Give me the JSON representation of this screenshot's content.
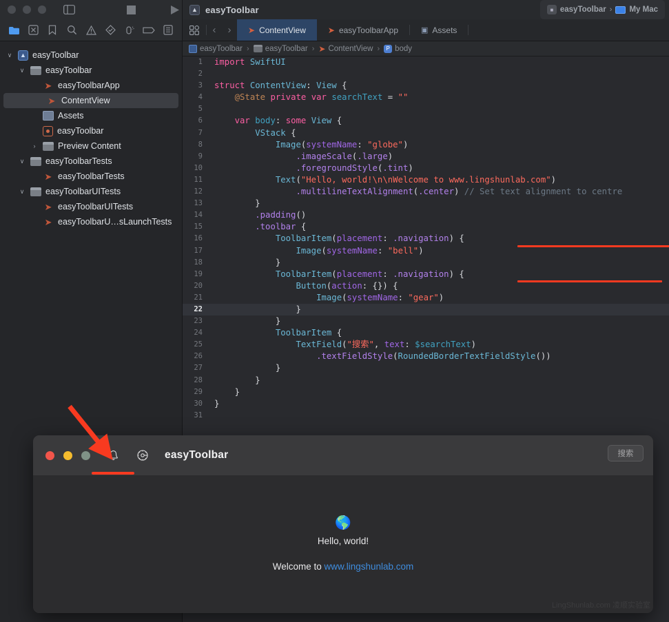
{
  "titlebar": {
    "window_controls": [
      "close",
      "minimize",
      "zoom"
    ],
    "sidebar_toggle_icon": "sidebar-toggle-icon",
    "grid_icon": "grid-icon",
    "run_icon": "run-play-icon",
    "project_icon": "xcode-project-icon",
    "project_title": "easyToolbar",
    "scheme": {
      "icon": "scheme-icon",
      "name": "easyToolbar",
      "chevron": "›",
      "device_icon": "mac-icon",
      "device": "My Mac"
    }
  },
  "navigator_toolbar": {
    "icons": [
      "folder-project-navigator-icon",
      "source-control-navigator-icon",
      "bookmark-navigator-icon",
      "find-navigator-icon",
      "issue-navigator-icon",
      "test-navigator-icon",
      "debug-navigator-icon",
      "breakpoint-navigator-icon",
      "report-navigator-icon"
    ]
  },
  "editor_tabbar": {
    "grid_button": "editor-grid-icon",
    "back_label": "‹",
    "forward_label": "›",
    "tabs": [
      {
        "label": "ContentView",
        "icon": "swift-file-icon",
        "selected": true
      },
      {
        "label": "easyToolbarApp",
        "icon": "swift-file-icon",
        "selected": false
      },
      {
        "label": "Assets",
        "icon": "assets-icon",
        "selected": false
      }
    ]
  },
  "breadcrumb": {
    "items": [
      {
        "label": "easyToolbar",
        "icon": "xcode-project-icon"
      },
      {
        "label": "easyToolbar",
        "icon": "folder-icon"
      },
      {
        "label": "ContentView",
        "icon": "swift-file-icon"
      },
      {
        "label": "body",
        "icon": "body-symbol-icon"
      }
    ],
    "separator": "›"
  },
  "sidebar": {
    "items": [
      {
        "label": "easyToolbar",
        "indent": 0,
        "disclosure": "∨",
        "icon": "xcode-project-icon",
        "selected": false
      },
      {
        "label": "easyToolbar",
        "indent": 1,
        "disclosure": "∨",
        "icon": "folder-icon",
        "selected": false
      },
      {
        "label": "easyToolbarApp",
        "indent": 2,
        "disclosure": "",
        "icon": "swift-file-icon",
        "selected": false
      },
      {
        "label": "ContentView",
        "indent": 2,
        "disclosure": "",
        "icon": "swift-file-icon",
        "selected": true
      },
      {
        "label": "Assets",
        "indent": 2,
        "disclosure": "",
        "icon": "assets-icon",
        "selected": false
      },
      {
        "label": "easyToolbar",
        "indent": 2,
        "disclosure": "",
        "icon": "entitlements-icon",
        "selected": false
      },
      {
        "label": "Preview Content",
        "indent": 2,
        "disclosure": "›",
        "icon": "folder-icon",
        "selected": false
      },
      {
        "label": "easyToolbarTests",
        "indent": 1,
        "disclosure": "∨",
        "icon": "folder-icon",
        "selected": false
      },
      {
        "label": "easyToolbarTests",
        "indent": 2,
        "disclosure": "",
        "icon": "swift-file-icon",
        "selected": false
      },
      {
        "label": "easyToolbarUITests",
        "indent": 1,
        "disclosure": "∨",
        "icon": "folder-icon",
        "selected": false
      },
      {
        "label": "easyToolbarUITests",
        "indent": 2,
        "disclosure": "",
        "icon": "swift-file-icon",
        "selected": false
      },
      {
        "label": "easyToolbarU…sLaunchTests",
        "indent": 2,
        "disclosure": "",
        "icon": "swift-file-icon",
        "selected": false
      }
    ]
  },
  "editor": {
    "current_line": 22,
    "lines": [
      {
        "n": 1,
        "html": "<span class='k'>import</span> <span class='t'>SwiftUI</span>"
      },
      {
        "n": 2,
        "html": ""
      },
      {
        "n": 3,
        "html": "<span class='k'>struct</span> <span class='t'>ContentView</span><span class='d'>: </span><span class='t'>View</span> <span class='d'>{</span>"
      },
      {
        "n": 4,
        "html": "    <span class='attr'>@State</span> <span class='k'>private</span> <span class='k'>var</span> <span class='v'>searchText</span> <span class='d'>= </span><span class='s'>\"\"</span>"
      },
      {
        "n": 5,
        "html": ""
      },
      {
        "n": 6,
        "html": "    <span class='k'>var</span> <span class='v'>body</span><span class='d'>: </span><span class='k'>some</span> <span class='t'>View</span> <span class='d'>{</span>"
      },
      {
        "n": 7,
        "html": "        <span class='t'>VStack</span> <span class='d'>{</span>"
      },
      {
        "n": 8,
        "html": "            <span class='t'>Image</span><span class='d'>(</span><span class='p'>systemName</span><span class='d'>: </span><span class='s'>\"globe\"</span><span class='d'>)</span>"
      },
      {
        "n": 9,
        "html": "                <span class='f'>.imageScale</span><span class='d'>(</span><span class='f'>.large</span><span class='d'>)</span>"
      },
      {
        "n": 10,
        "html": "                <span class='f'>.foregroundStyle</span><span class='d'>(</span><span class='f'>.tint</span><span class='d'>)</span>"
      },
      {
        "n": 11,
        "html": "            <span class='t'>Text</span><span class='d'>(</span><span class='s'>\"Hello, world!\\n\\nWelcome to www.lingshunlab.com\"</span><span class='d'>)</span>"
      },
      {
        "n": 12,
        "html": "                <span class='f'>.multilineTextAlignment</span><span class='d'>(</span><span class='f'>.center</span><span class='d'>) </span><span class='c'>// Set text alignment to centre</span>"
      },
      {
        "n": 13,
        "html": "        <span class='d'>}</span>"
      },
      {
        "n": 14,
        "html": "        <span class='f'>.padding</span><span class='d'>()</span>"
      },
      {
        "n": 15,
        "html": "        <span class='f'>.toolbar</span> <span class='d'>{</span>"
      },
      {
        "n": 16,
        "html": "            <span class='t'>ToolbarItem</span><span class='d'>(</span><span class='p'>placement</span><span class='d'>: </span><span class='f'>.navigation</span><span class='d'>) {</span>"
      },
      {
        "n": 17,
        "html": "                <span class='t'>Image</span><span class='d'>(</span><span class='p'>systemName</span><span class='d'>: </span><span class='s'>\"bell\"</span><span class='d'>)</span>"
      },
      {
        "n": 18,
        "html": "            <span class='d'>}</span>"
      },
      {
        "n": 19,
        "html": "            <span class='t'>ToolbarItem</span><span class='d'>(</span><span class='p'>placement</span><span class='d'>: </span><span class='f'>.navigation</span><span class='d'>) {</span>"
      },
      {
        "n": 20,
        "html": "                <span class='t'>Button</span><span class='d'>(</span><span class='p'>action</span><span class='d'>: {}) {</span>"
      },
      {
        "n": 21,
        "html": "                    <span class='t'>Image</span><span class='d'>(</span><span class='p'>systemName</span><span class='d'>: </span><span class='s'>\"gear\"</span><span class='d'>)</span>"
      },
      {
        "n": 22,
        "html": "                <span class='d'>}</span>"
      },
      {
        "n": 23,
        "html": "            <span class='d'>}</span>"
      },
      {
        "n": 24,
        "html": "            <span class='t'>ToolbarItem</span> <span class='d'>{</span>"
      },
      {
        "n": 25,
        "html": "                <span class='t'>TextField</span><span class='d'>(</span><span class='s'>\"搜索\"</span><span class='d'>, </span><span class='p'>text</span><span class='d'>: </span><span class='v'>$searchText</span><span class='d'>)</span>"
      },
      {
        "n": 26,
        "html": "                    <span class='f'>.textFieldStyle</span><span class='d'>(</span><span class='t'>RoundedBorderTextFieldStyle</span><span class='d'>())</span>"
      },
      {
        "n": 27,
        "html": "            <span class='d'>}</span>"
      },
      {
        "n": 28,
        "html": "        <span class='d'>}</span>"
      },
      {
        "n": 29,
        "html": "    <span class='d'>}</span>"
      },
      {
        "n": 30,
        "html": "<span class='d'>}</span>"
      },
      {
        "n": 31,
        "html": ""
      }
    ]
  },
  "app_window": {
    "traffic_lights": [
      "close",
      "minimize",
      "zoom"
    ],
    "bell_icon": "bell-icon",
    "gear_icon": "gear-icon",
    "title": "easyToolbar",
    "search_placeholder": "搜索",
    "search_value": "",
    "content": {
      "globe_icon": "globe-icon",
      "hello_text": "Hello, world!",
      "welcome_prefix": "Welcome to ",
      "welcome_link": "www.lingshunlab.com"
    },
    "watermark": "LingShunlab.com 凌顺实验室"
  },
  "annotations": {
    "arrow_color": "#f83a20",
    "underline_color": "#f83a20",
    "arrow_target": "bell-toolbar-item"
  },
  "colors": {
    "accent_blue": "#3f8cdd",
    "tab_selected": "#2d4566",
    "swift_orange": "#c0563a",
    "annotation_red": "#f83a20"
  }
}
